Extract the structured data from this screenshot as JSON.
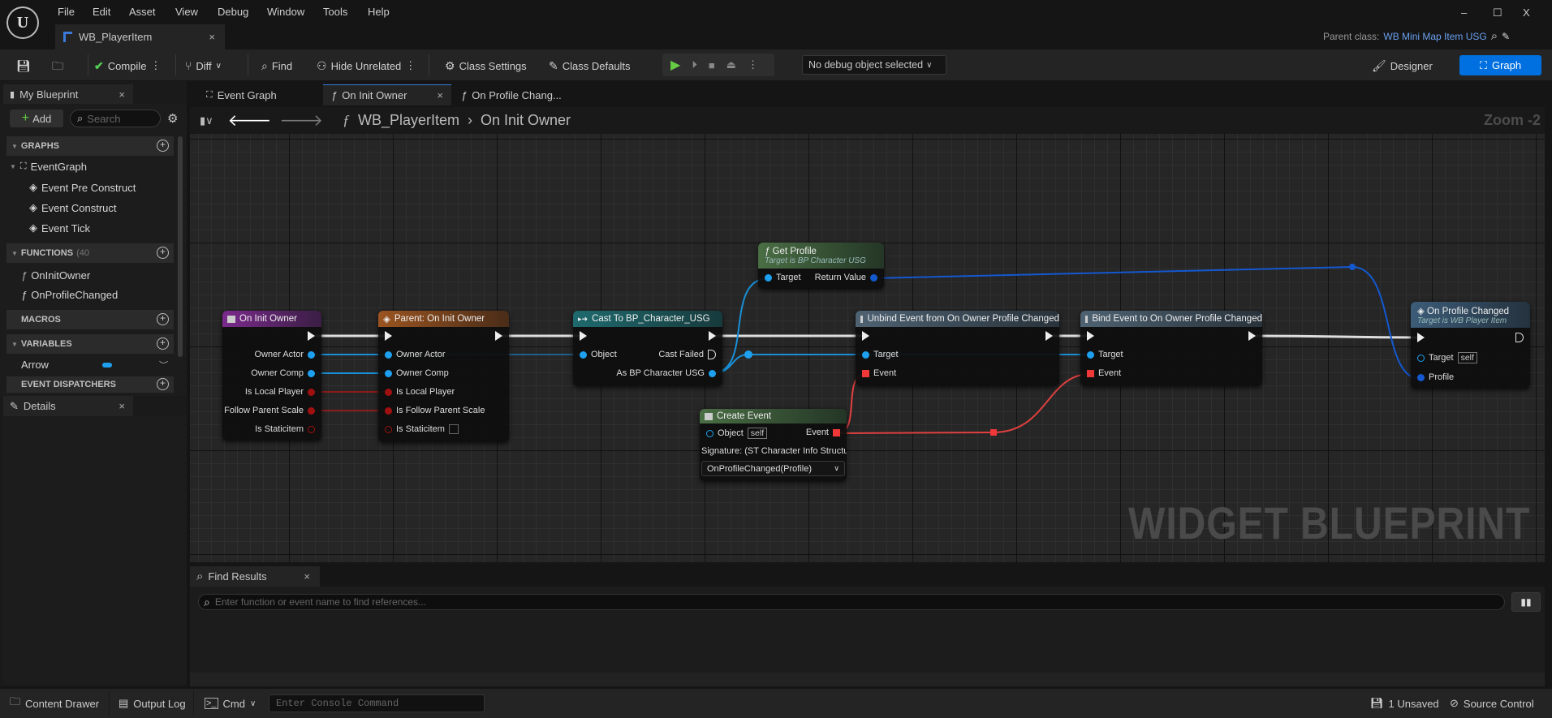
{
  "menu": [
    "File",
    "Edit",
    "Asset",
    "View",
    "Debug",
    "Window",
    "Tools",
    "Help"
  ],
  "asset_tab": {
    "label": "WB_PlayerItem",
    "close": "×"
  },
  "window_controls": {
    "minimize": "–",
    "maximize": "☐",
    "close": "X"
  },
  "parent_class": {
    "label": "Parent class:",
    "value": "WB Mini Map Item USG"
  },
  "toolbar": {
    "compile": "Compile",
    "diff": "Diff",
    "find": "Find",
    "hide_unrelated": "Hide Unrelated",
    "class_settings": "Class Settings",
    "class_defaults": "Class Defaults",
    "debug_object": "No debug object selected",
    "designer": "Designer",
    "graph": "Graph"
  },
  "my_blueprint": {
    "tab": "My Blueprint",
    "close": "×",
    "add": "Add",
    "search_placeholder": "Search",
    "sections": {
      "graphs": "GRAPHS",
      "functions": "FUNCTIONS",
      "functions_count": "(40",
      "macros": "MACROS",
      "variables": "VARIABLES",
      "dispatchers": "EVENT DISPATCHERS"
    },
    "graphs": [
      "EventGraph",
      "Event Pre Construct",
      "Event Construct",
      "Event Tick"
    ],
    "functions": [
      "OnInitOwner",
      "OnProfileChanged"
    ],
    "variables": [
      {
        "name": "Arrow",
        "type_color": "#1ea0f0"
      }
    ]
  },
  "details": {
    "tab": "Details",
    "close": "×"
  },
  "graph_tabs": [
    {
      "label": "Event Graph"
    },
    {
      "label": "On Init Owner",
      "close": "×"
    },
    {
      "label": "On Profile Chang..."
    }
  ],
  "breadcrumb": {
    "root": "WB_PlayerItem",
    "separator": "›",
    "current": "On Init Owner"
  },
  "zoom_label": "Zoom -2",
  "watermark": "WIDGET BLUEPRINT",
  "nodes": {
    "on_init_owner": {
      "title": "On Init Owner",
      "pins": [
        "Owner Actor",
        "Owner Comp",
        "Is Local Player",
        "Is Follow Parent Scale",
        "Is Staticitem"
      ]
    },
    "parent": {
      "title": "Parent: On Init Owner",
      "pins": [
        "Owner Actor",
        "Owner Comp",
        "Is Local Player",
        "Is Follow Parent Scale",
        "Is Staticitem"
      ]
    },
    "cast": {
      "title": "Cast To BP_Character_USG",
      "object": "Object",
      "cast_failed": "Cast Failed",
      "as": "As BP Character USG"
    },
    "get_profile": {
      "title": "Get Profile",
      "subtitle": "Target is BP Character USG",
      "target": "Target",
      "return": "Return Value"
    },
    "unbind": {
      "title": "Unbind Event from On Owner Profile Changed",
      "target": "Target",
      "event": "Event"
    },
    "bind": {
      "title": "Bind Event to On Owner Profile Changed",
      "target": "Target",
      "event": "Event"
    },
    "on_profile_changed": {
      "title": "On Profile Changed",
      "subtitle": "Target is WB Player Item",
      "target": "Target",
      "self": "self",
      "profile": "Profile"
    },
    "create_event": {
      "title": "Create Event",
      "object": "Object",
      "self": "self",
      "event": "Event",
      "signature": "Signature: (ST Character Info Structure)",
      "function": "OnProfileChanged(Profile)"
    }
  },
  "find_results": {
    "tab": "Find Results",
    "close": "×",
    "placeholder": "Enter function or event name to find references..."
  },
  "status_bar": {
    "content_drawer": "Content Drawer",
    "output_log": "Output Log",
    "cmd": "Cmd",
    "console_placeholder": "Enter Console Command",
    "unsaved": "1 Unsaved",
    "source_control": "Source Control"
  },
  "colors": {
    "accent": "#0070e0",
    "object_pin": "#1ea0f0",
    "bool_pin": "#a01010",
    "delegate_pin": "#f03838",
    "struct_pin": "#1458d0",
    "parent_class": "#6aa0f0"
  }
}
